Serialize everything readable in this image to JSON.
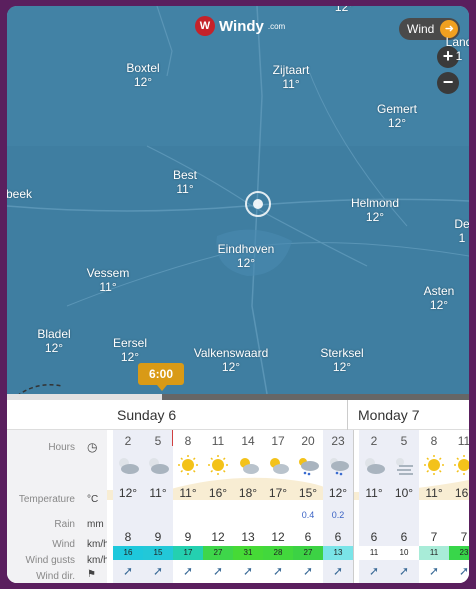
{
  "map": {
    "logo": {
      "name": "Windy",
      "suffix": ".com",
      "mark": "W"
    },
    "layer_button": {
      "label": "Wind"
    },
    "zoom": {
      "in_label": "+",
      "out_label": "−"
    },
    "cities": [
      {
        "name": "Boxtel",
        "temp": "12°"
      },
      {
        "name": "Zijtaart",
        "temp": "11°"
      },
      {
        "name": "Gemert",
        "temp": "12°"
      },
      {
        "name": "Best",
        "temp": "11°"
      },
      {
        "name": "Helmond",
        "temp": "12°"
      },
      {
        "name": "Eindhoven",
        "temp": "12°"
      },
      {
        "name": "Vessem",
        "temp": "11°"
      },
      {
        "name": "Asten",
        "temp": "12°"
      },
      {
        "name": "Bladel",
        "temp": "12°"
      },
      {
        "name": "Eersel",
        "temp": "12°"
      },
      {
        "name": "Valkenswaard",
        "temp": "12°"
      },
      {
        "name": "Sterksel",
        "temp": "12°"
      },
      {
        "name": "beek",
        "temp": ""
      },
      {
        "name": "De",
        "temp": "1"
      },
      {
        "name": "Land",
        "temp": "1"
      },
      {
        "name": "",
        "temp": "12°"
      }
    ],
    "time_flag": "6:00"
  },
  "forecast": {
    "days": [
      "Sunday 6",
      "Monday 7"
    ],
    "row_labels": {
      "hours": "Hours",
      "temperature": "Temperature",
      "temperature_unit": "°C",
      "rain": "Rain",
      "rain_unit": "mm",
      "wind": "Wind",
      "wind_unit": "km/h",
      "gusts": "Wind gusts",
      "gusts_unit": "km/h",
      "dir": "Wind dir."
    },
    "columns": [
      {
        "hour": "2",
        "icon": "night-cloudy-icon",
        "temp": "12°",
        "rain": "",
        "wind": "8",
        "gust": "16",
        "gust_color": "#1ec8dc",
        "night": true
      },
      {
        "hour": "5",
        "icon": "night-cloudy-icon",
        "temp": "11°",
        "rain": "",
        "wind": "9",
        "gust": "15",
        "gust_color": "#22c8d8",
        "night": true
      },
      {
        "hour": "8",
        "icon": "sunny-icon",
        "temp": "11°",
        "rain": "",
        "wind": "9",
        "gust": "17",
        "gust_color": "#24d0b0",
        "night": false
      },
      {
        "hour": "11",
        "icon": "sunny-icon",
        "temp": "16°",
        "rain": "",
        "wind": "12",
        "gust": "27",
        "gust_color": "#3ed64a",
        "night": false
      },
      {
        "hour": "14",
        "icon": "partly-cloudy-icon",
        "temp": "18°",
        "rain": "",
        "wind": "13",
        "gust": "31",
        "gust_color": "#46da36",
        "night": false
      },
      {
        "hour": "17",
        "icon": "partly-cloudy-icon",
        "temp": "17°",
        "rain": "",
        "wind": "12",
        "gust": "28",
        "gust_color": "#42d83c",
        "night": false
      },
      {
        "hour": "20",
        "icon": "rain-cloud-icon",
        "temp": "15°",
        "rain": "0.4",
        "wind": "6",
        "gust": "27",
        "gust_color": "#3cd244",
        "night": false
      },
      {
        "hour": "23",
        "icon": "night-rain-icon",
        "temp": "12°",
        "rain": "0.2",
        "wind": "6",
        "gust": "13",
        "gust_color": "#7ae4e8",
        "night": true
      },
      {
        "hour": "2",
        "icon": "night-cloudy-icon",
        "temp": "11°",
        "rain": "",
        "wind": "6",
        "gust": "11",
        "gust_color": "#ffffff",
        "night": true
      },
      {
        "hour": "5",
        "icon": "fog-icon",
        "temp": "10°",
        "rain": "",
        "wind": "6",
        "gust": "10",
        "gust_color": "#ffffff",
        "night": true
      },
      {
        "hour": "8",
        "icon": "sunny-icon",
        "temp": "11°",
        "rain": "",
        "wind": "7",
        "gust": "11",
        "gust_color": "#a8ecd8",
        "night": false
      },
      {
        "hour": "11",
        "icon": "sunny-icon",
        "temp": "16°",
        "rain": "",
        "wind": "7",
        "gust": "23",
        "gust_color": "#38d64a",
        "night": false
      }
    ],
    "wind_dir_glyph": "➚"
  }
}
